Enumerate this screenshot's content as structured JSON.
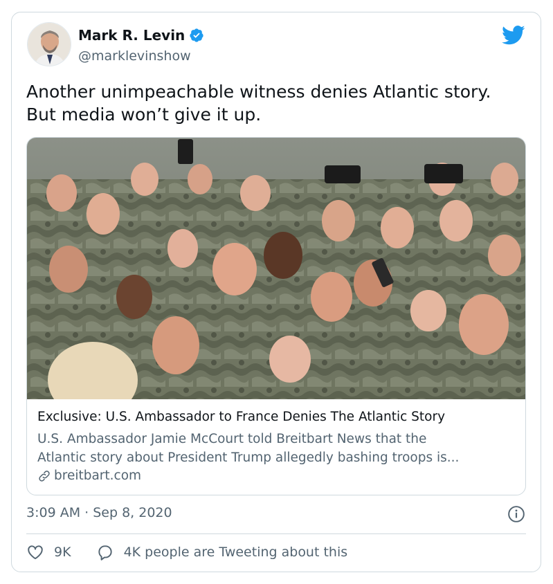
{
  "author": {
    "display_name": "Mark R. Levin",
    "handle": "@marklevinshow",
    "verified": true
  },
  "tweet": {
    "line1": "Another unimpeachable witness denies Atlantic story.",
    "line2": "But media won’t give it up."
  },
  "card": {
    "title": "Exclusive: U.S. Ambassador to France Denies The Atlantic Story",
    "description_line1": "U.S. Ambassador Jamie McCourt told Breitbart News that the",
    "description_line2": "Atlantic story about President Trump allegedly bashing troops is...",
    "domain": "breitbart.com"
  },
  "meta": {
    "timestamp": "3:09 AM · Sep 8, 2020"
  },
  "actions": {
    "likes": "9K",
    "conversation": "4K people are Tweeting about this"
  },
  "colors": {
    "text_primary": "#0f1419",
    "text_secondary": "#536471",
    "border": "#cfd9de",
    "twitter_blue": "#1d9bf0"
  },
  "icons": [
    "verified-badge-icon",
    "twitter-bird-icon",
    "link-icon",
    "info-icon",
    "heart-icon",
    "speech-bubble-icon"
  ]
}
